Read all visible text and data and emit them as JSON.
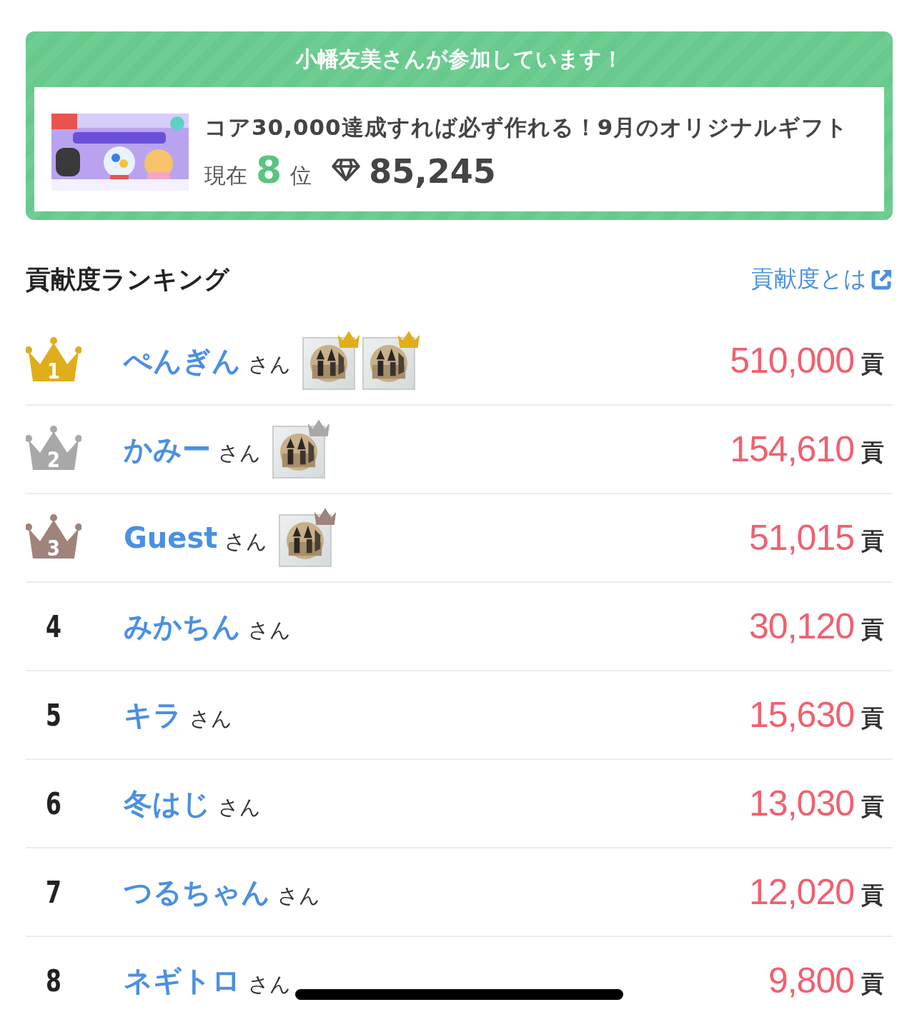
{
  "event_card": {
    "heading": "小幡友美さんが参加しています！",
    "title": "コア30,000達成すれば必ず作れる！9月のオリジナルギフト",
    "rank_prefix": "現在",
    "rank": "8",
    "rank_suffix": "位",
    "score": "85,245"
  },
  "ranking": {
    "title": "貢献度ランキング",
    "help_link": "貢献度とは",
    "rows": [
      {
        "rank": "1",
        "color": "#e0ad1c",
        "name": "ぺんぎん",
        "honorific": "さん",
        "points": "510,000",
        "unit": "貢"
      },
      {
        "rank": "2",
        "color": "#a8a8a8",
        "name": "かみー",
        "honorific": "さん",
        "points": "154,610",
        "unit": "貢"
      },
      {
        "rank": "3",
        "color": "#a0837a",
        "name": "Guest",
        "honorific": "さん",
        "points": "51,015",
        "unit": "貢"
      },
      {
        "rank": "4",
        "name": "みかちん",
        "honorific": "さん",
        "avatars": [],
        "points": "30,120",
        "unit": "貢"
      },
      {
        "rank": "5",
        "name": "キラ",
        "honorific": "さん",
        "avatars": [],
        "points": "15,630",
        "unit": "貢"
      },
      {
        "rank": "6",
        "name": "冬はじ",
        "honorific": "さん",
        "avatars": [],
        "points": "13,030",
        "unit": "貢"
      },
      {
        "rank": "7",
        "name": "つるちゃん",
        "honorific": "さん",
        "avatars": [],
        "points": "12,020",
        "unit": "貢"
      },
      {
        "rank": "8",
        "name": "ネギトロ",
        "honorific": "さん",
        "avatars": [],
        "points": "9,800",
        "unit": "貢"
      }
    ]
  }
}
